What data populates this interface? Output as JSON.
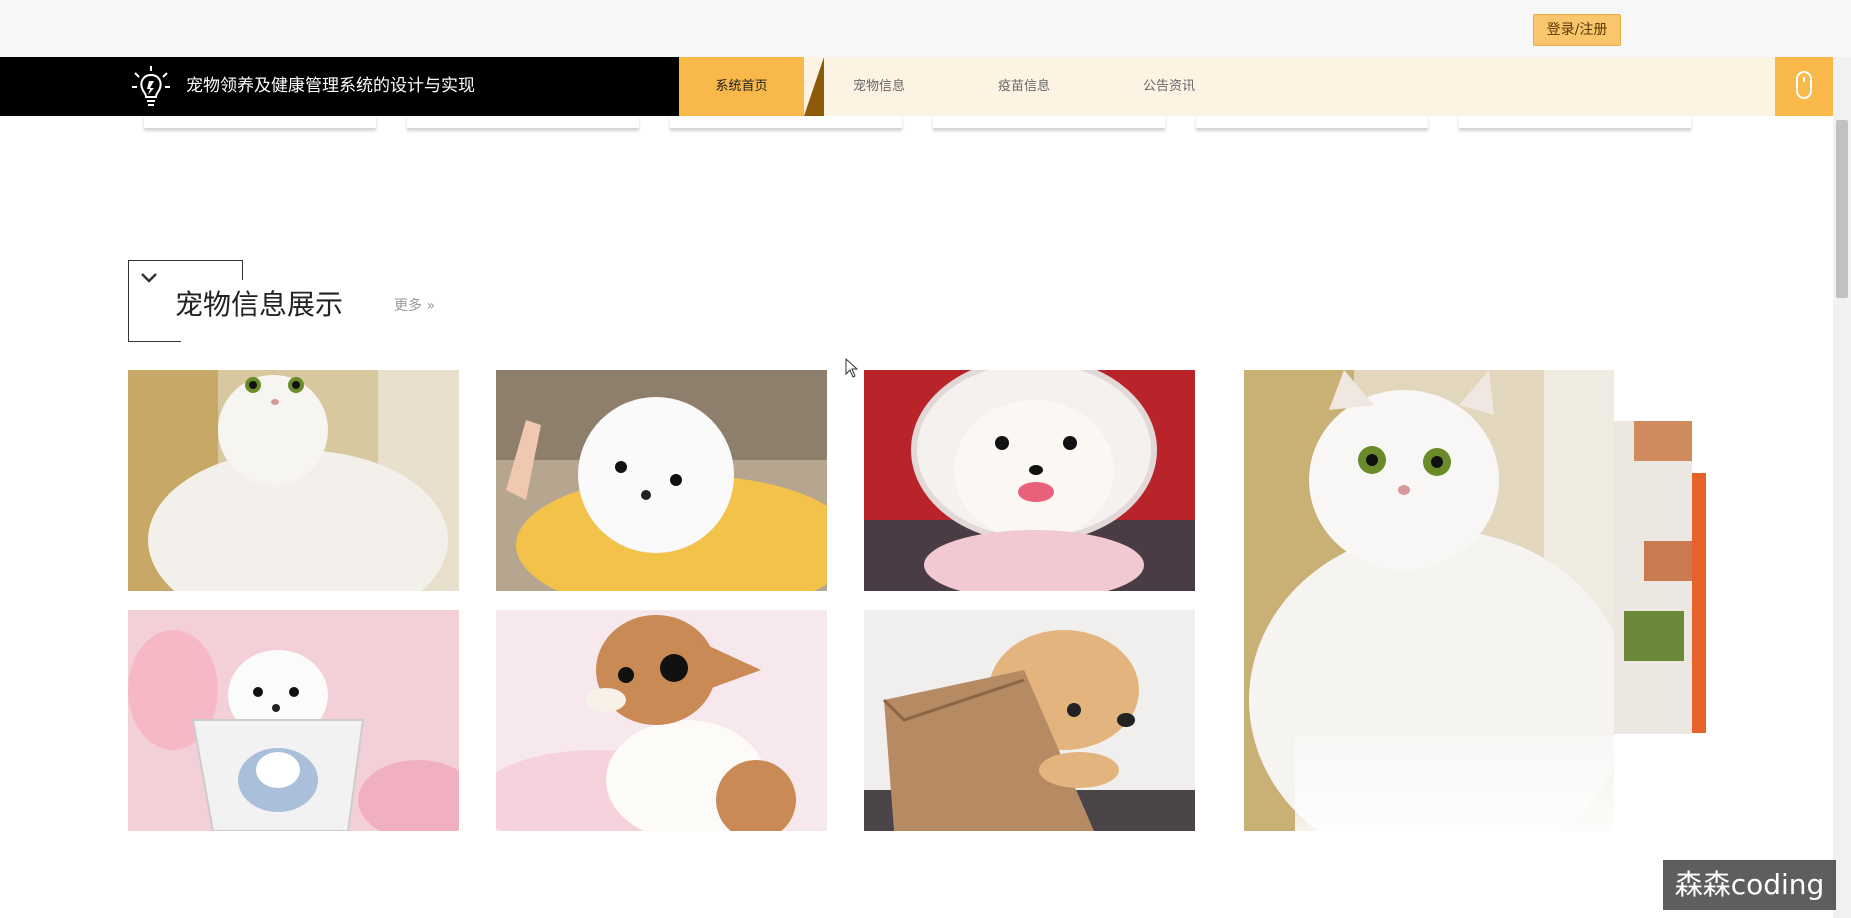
{
  "header": {
    "login_label": "登录/注册"
  },
  "brand": {
    "title": "宠物领养及健康管理系统的设计与实现"
  },
  "nav": {
    "items": [
      "系统首页",
      "宠物信息",
      "疫苗信息",
      "公告资讯"
    ],
    "active": "系统首页"
  },
  "section": {
    "title": "宠物信息展示",
    "more": "更多"
  },
  "pets": [
    {
      "kind": "cat"
    },
    {
      "kind": "dog"
    },
    {
      "kind": "dog"
    },
    {
      "kind": "dog"
    },
    {
      "kind": "dog"
    },
    {
      "kind": "dog"
    },
    {
      "kind": "cat"
    }
  ],
  "watermark": "森森coding",
  "colors": {
    "accent": "#f9b84a",
    "nav_bg": "#fdf3e3",
    "brand_bg": "#000000",
    "login_bg": "#f9c66b"
  }
}
